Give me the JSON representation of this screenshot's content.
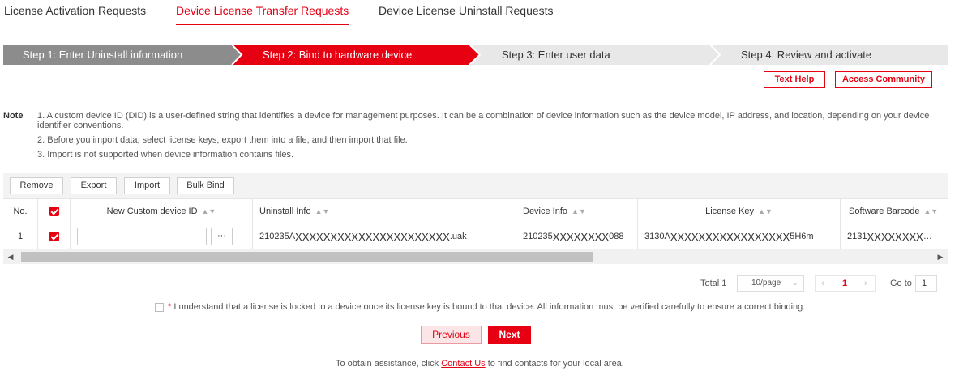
{
  "tabs": [
    {
      "label": "License Activation Requests"
    },
    {
      "label": "Device License Transfer Requests",
      "active": true
    },
    {
      "label": "Device License Uninstall Requests"
    }
  ],
  "steps": [
    {
      "label": "Step 1: Enter Uninstall information",
      "state": "done"
    },
    {
      "label": "Step 2: Bind to hardware device",
      "state": "active"
    },
    {
      "label": "Step 3: Enter user data",
      "state": "pending"
    },
    {
      "label": "Step 4: Review and activate",
      "state": "pending"
    }
  ],
  "help": {
    "text_help": "Text Help",
    "access_community": "Access Community"
  },
  "note": {
    "title": "Note",
    "lines": [
      "1. A custom device ID (DID) is a user-defined string that identifies a device for management purposes. It can be a combination of device information such as the device model, IP address, and location, depending on your device",
      "identifier conventions.",
      "2. Before you import data, select license keys, export them into a file, and then import that file.",
      "3. Import is not supported when device information contains files."
    ]
  },
  "toolbar": {
    "remove": "Remove",
    "export": "Export",
    "import": "Import",
    "bulk_bind": "Bulk Bind"
  },
  "table": {
    "headers": {
      "no": "No.",
      "custom_id": "New Custom device ID",
      "uninstall_info": "Uninstall Info",
      "device_info": "Device Info",
      "license_key": "License Key",
      "software_barcode": "Software Barcode"
    },
    "rows": [
      {
        "no": "1",
        "dots": "···",
        "uninstall_pre": "210235A",
        "uninstall_mask": "XXXXXXXXXXXXXXXXXXXXXX",
        "uninstall_post": ".uak",
        "device_pre": "210235",
        "device_mask": "XXXXXXXX",
        "device_post": "088",
        "license_pre": "3130A",
        "license_mask": "XXXXXXXXXXXXXXXXX",
        "license_post": "5H6m",
        "barcode_pre": "2131",
        "barcode_mask": "XXXXXXXX",
        "barcode_post": "…"
      }
    ]
  },
  "pagination": {
    "total_label": "Total 1",
    "per_page": "10/page",
    "current_page": "1",
    "goto_label": "Go to",
    "goto_value": "1"
  },
  "agreement": {
    "required_mark": "*",
    "text": " I understand that a license is locked to a device once its license key is bound to that device. All information must be verified carefully to ensure a correct binding."
  },
  "buttons": {
    "previous": "Previous",
    "next": "Next"
  },
  "footer": {
    "before": "To obtain assistance, click ",
    "link": "Contact Us",
    "after": " to find contacts for your local area."
  },
  "colors": {
    "accent": "#e60012",
    "step_done": "#8c8c8c",
    "step_pending": "#e8e8e8"
  }
}
